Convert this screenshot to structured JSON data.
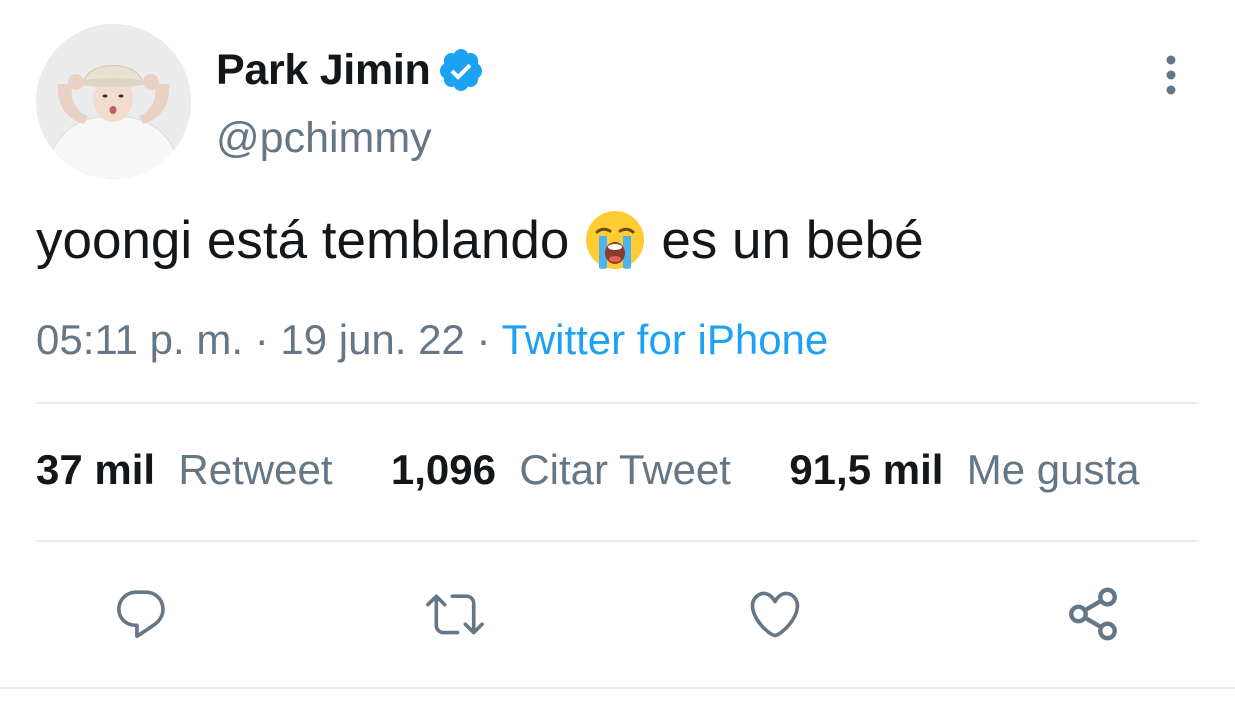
{
  "user": {
    "display_name": "Park Jimin",
    "handle": "@pchimmy",
    "verified": true,
    "avatar_icon": "profile-photo"
  },
  "tweet": {
    "text_before": "yoongi está temblando",
    "emoji": "loudly-crying-face",
    "text_after": "es un bebé"
  },
  "meta": {
    "time": "05:11 p. m.",
    "sep1": "·",
    "date": "19 jun. 22",
    "sep2": "·",
    "source": "Twitter for iPhone"
  },
  "stats": {
    "retweets_count": "37 mil",
    "retweets_label": "Retweet",
    "quotes_count": "1,096",
    "quotes_label": "Citar Tweet",
    "likes_count": "91,5 mil",
    "likes_label": "Me gusta"
  },
  "actions": {
    "reply_icon": "reply-icon",
    "retweet_icon": "retweet-icon",
    "like_icon": "heart-icon",
    "share_icon": "share-icon"
  },
  "colors": {
    "text": "#14171a",
    "secondary": "#657786",
    "accent": "#1da1f2",
    "divider": "#e6ecf0"
  }
}
